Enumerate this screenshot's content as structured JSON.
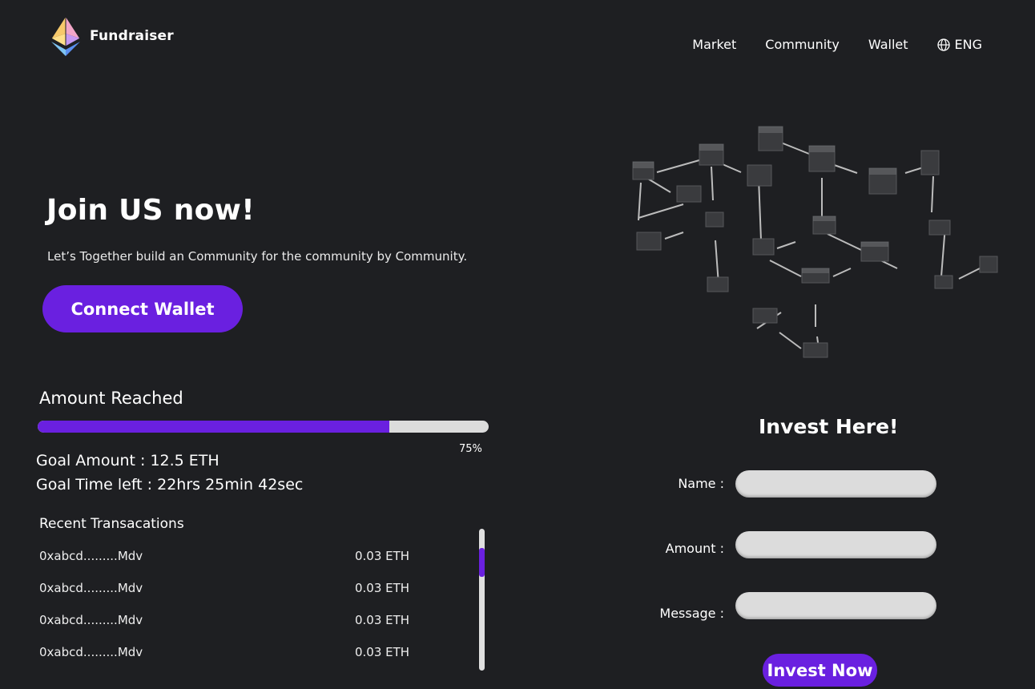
{
  "brand": {
    "name": "Fundraiser",
    "logo_icon": "ethereum-diamond-icon"
  },
  "nav": {
    "items": [
      {
        "label": "Market"
      },
      {
        "label": "Community"
      },
      {
        "label": "Wallet"
      }
    ],
    "language": {
      "label": "ENG",
      "icon": "globe-icon"
    }
  },
  "hero": {
    "title": "Join US now!",
    "subtitle": "Let’s Together build an Community for the community by Community.",
    "connect_label": "Connect Wallet"
  },
  "progress": {
    "title": "Amount Reached",
    "percent_label": "75%",
    "fill_fraction": 0.78
  },
  "goal": {
    "amount": "Goal Amount : 12.5 ETH",
    "time_left": "Goal Time left : 22hrs 25min 42sec"
  },
  "transactions": {
    "title": "Recent Transacations",
    "rows": [
      {
        "address": "0xabcd.........Mdv",
        "amount": "0.03 ETH"
      },
      {
        "address": "0xabcd.........Mdv",
        "amount": "0.03 ETH"
      },
      {
        "address": "0xabcd.........Mdv",
        "amount": "0.03 ETH"
      },
      {
        "address": "0xabcd.........Mdv",
        "amount": "0.03 ETH"
      }
    ]
  },
  "invest": {
    "title": "Invest Here!",
    "name_label": "Name :",
    "amount_label": "Amount :",
    "message_label": "Message :",
    "name_value": "",
    "amount_value": "",
    "message_value": "",
    "button_label": "Invest Now"
  },
  "colors": {
    "background": "#1e1f22",
    "accent": "#6a20e0",
    "input_bg": "#dcdcdc",
    "text": "#ffffff"
  }
}
